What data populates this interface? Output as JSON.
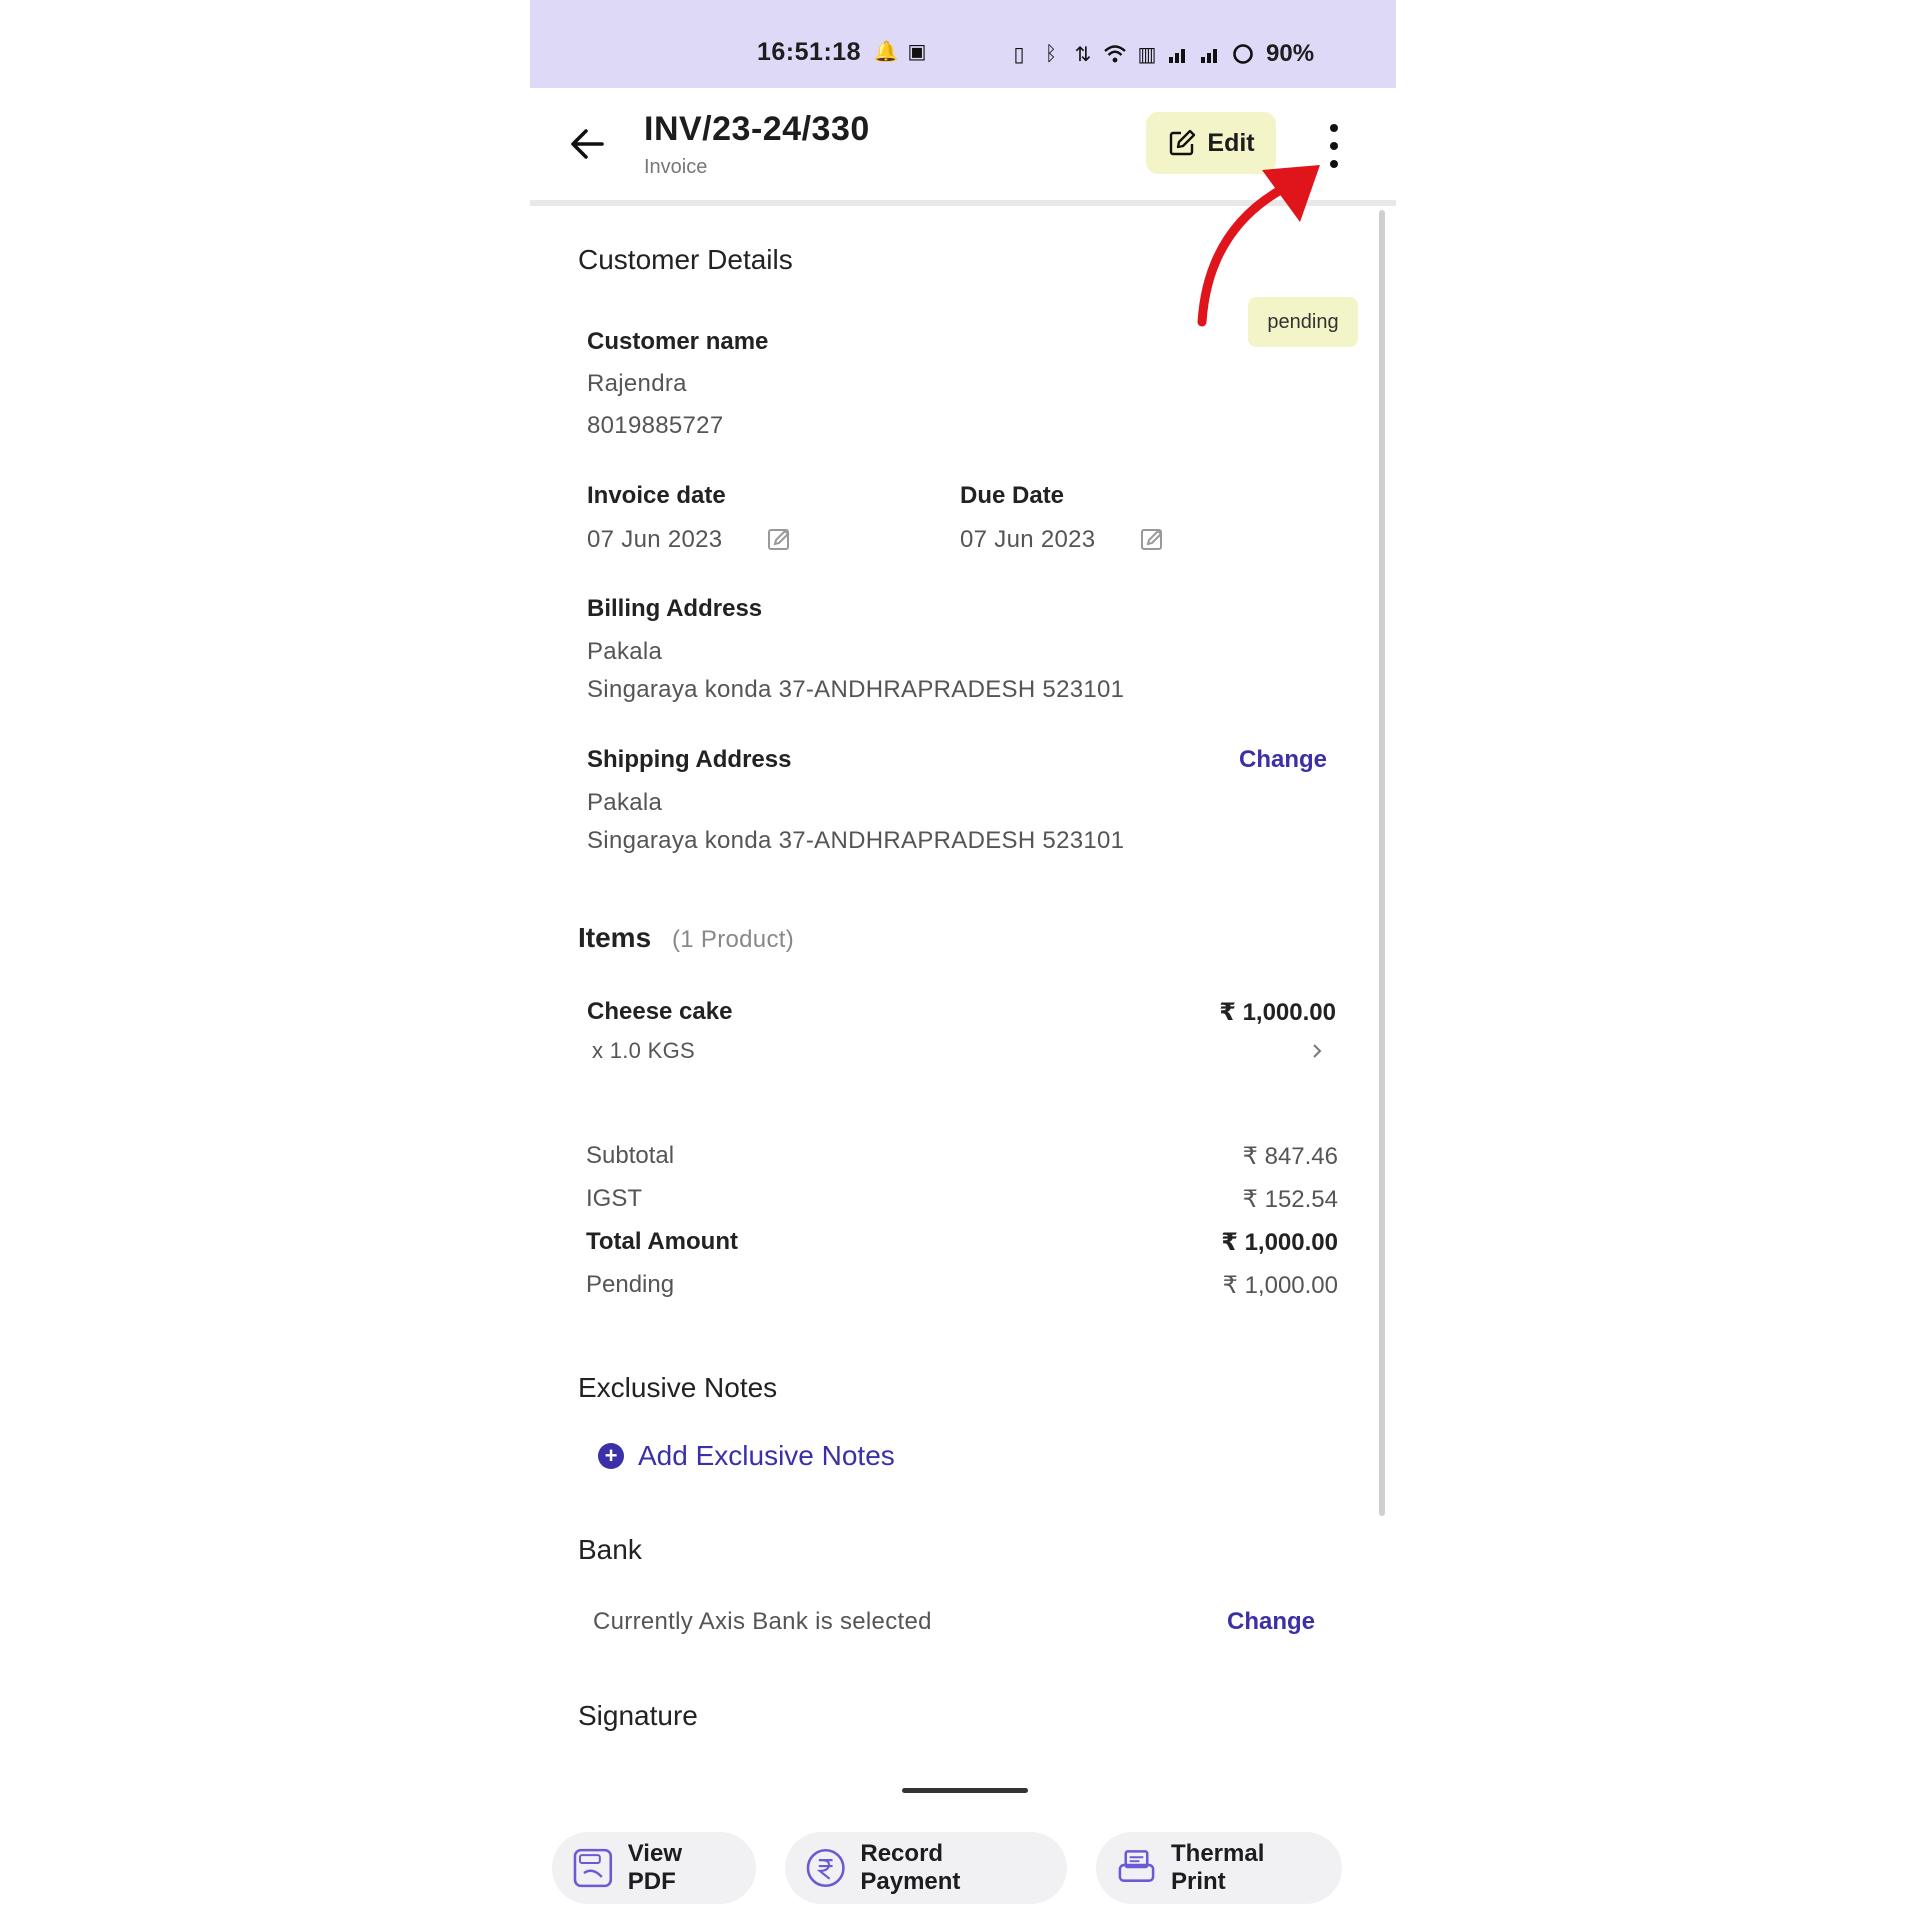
{
  "status_bar": {
    "time": "16:51:18",
    "battery": "90%"
  },
  "header": {
    "title": "INV/23-24/330",
    "subtitle": "Invoice",
    "edit_label": "Edit"
  },
  "status_badge": "pending",
  "customer": {
    "section_title": "Customer Details",
    "name_label": "Customer name",
    "name": "Rajendra",
    "phone": "8019885727"
  },
  "dates": {
    "invoice_label": "Invoice date",
    "invoice_date": "07 Jun 2023",
    "due_label": "Due Date",
    "due_date": "07 Jun 2023"
  },
  "billing": {
    "label": "Billing Address",
    "line1": "Pakala",
    "line2": "Singaraya konda 37-ANDHRAPRADESH 523101"
  },
  "shipping": {
    "label": "Shipping Address",
    "change": "Change",
    "line1": "Pakala",
    "line2": "Singaraya konda 37-ANDHRAPRADESH 523101"
  },
  "items": {
    "title": "Items",
    "count": "(1 Product)",
    "list": [
      {
        "name": "Cheese cake",
        "qty": "x 1.0 KGS",
        "price": "₹ 1,000.00"
      }
    ]
  },
  "totals": [
    {
      "label": "Subtotal",
      "value": "₹ 847.46"
    },
    {
      "label": "IGST",
      "value": "₹ 152.54"
    },
    {
      "label": "Total Amount",
      "value": "₹ 1,000.00"
    },
    {
      "label": "Pending",
      "value": "₹ 1,000.00"
    }
  ],
  "notes": {
    "title": "Exclusive Notes",
    "add_label": "Add Exclusive Notes"
  },
  "bank": {
    "title": "Bank",
    "text": "Currently Axis Bank is selected",
    "change": "Change"
  },
  "signature": {
    "title": "Signature"
  },
  "bottom_actions": {
    "view_pdf": "View PDF",
    "record_payment": "Record Payment",
    "thermal_print": "Thermal Print"
  },
  "colors": {
    "status_bar_bg": "#ddd9f7",
    "accent": "#3b30a8",
    "badge_bg": "#f3f5c8",
    "annotation_arrow": "#e0141b"
  }
}
